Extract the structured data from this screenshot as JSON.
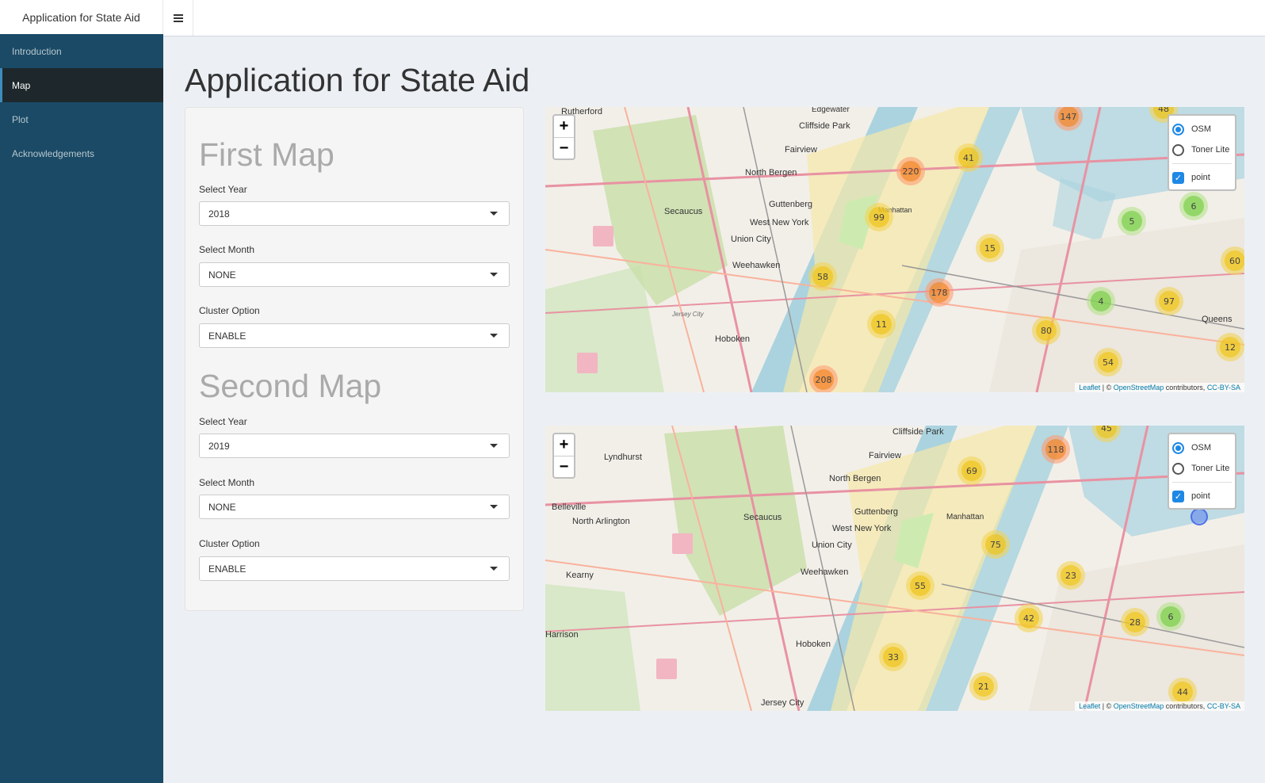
{
  "header": {
    "app_title": "Application for State Aid",
    "menu_icon": "hamburger-icon"
  },
  "sidebar": {
    "items": [
      {
        "label": "Introduction",
        "active": false
      },
      {
        "label": "Map",
        "active": true
      },
      {
        "label": "Plot",
        "active": false
      },
      {
        "label": "Acknowledgements",
        "active": false
      }
    ]
  },
  "main": {
    "title": "Application for State Aid",
    "first_map": {
      "heading": "First Map",
      "year_label": "Select Year",
      "year_value": "2018",
      "month_label": "Select Month",
      "month_value": "NONE",
      "cluster_label": "Cluster Option",
      "cluster_value": "ENABLE"
    },
    "second_map": {
      "heading": "Second Map",
      "year_label": "Select Year",
      "year_value": "2019",
      "month_label": "Select Month",
      "month_value": "NONE",
      "cluster_label": "Cluster Option",
      "cluster_value": "ENABLE"
    }
  },
  "map_controls": {
    "zoom_in": "+",
    "zoom_out": "−",
    "layer_osm": "OSM",
    "layer_toner": "Toner Lite",
    "overlay_point": "point",
    "attribution_leaflet": "Leaflet",
    "attribution_sep": " | © ",
    "attribution_osm": "OpenStreetMap",
    "attribution_contrib": " contributors, ",
    "attribution_license": "CC-BY-SA"
  },
  "map1": {
    "labels": [
      "Rutherford",
      "Edgewater",
      "Cliffside Park",
      "Fairview",
      "North Bergen",
      "Guttenberg",
      "Secaucus",
      "West New York",
      "Union City",
      "Weehawken",
      "Hoboken",
      "Manhattan",
      "Queens",
      "Jersey City"
    ],
    "clusters": [
      "147",
      "41",
      "220",
      "99",
      "6",
      "5",
      "15",
      "60",
      "58",
      "178",
      "4",
      "97",
      "11",
      "80",
      "12",
      "54",
      "208",
      "48"
    ]
  },
  "map2": {
    "labels": [
      "Cliffside Park",
      "Lyndhurst",
      "Fairview",
      "North Bergen",
      "Belleville",
      "North Arlington",
      "Secaucus",
      "Guttenberg",
      "Manhattan",
      "West New York",
      "Union City",
      "Kearny",
      "Weehawken",
      "Harrison",
      "Hoboken",
      "Jersey City"
    ],
    "clusters": [
      "118",
      "45",
      "69",
      "75",
      "55",
      "23",
      "42",
      "28",
      "6",
      "33",
      "21",
      "44"
    ]
  }
}
